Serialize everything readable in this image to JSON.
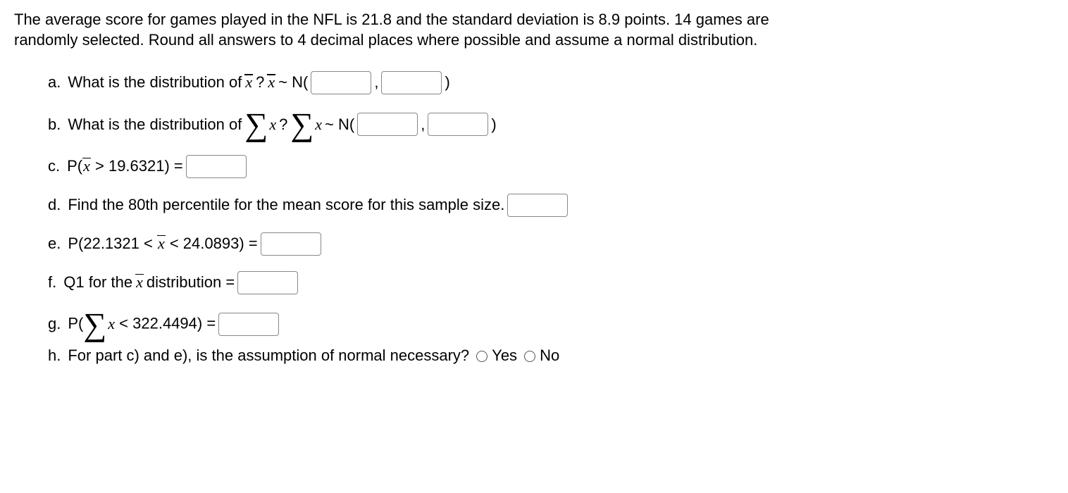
{
  "intro": "The average score for games played in the NFL is 21.8 and the standard deviation is 8.9 points. 14 games are randomly selected. Round all answers to 4 decimal places where possible and assume a normal distribution.",
  "a": {
    "label": "a.",
    "pre": "What is the distribution of ",
    "q": "? ",
    "dist": " ~ N(",
    "comma": ",",
    "close": ")"
  },
  "b": {
    "label": "b.",
    "pre": "What is the distribution of ",
    "q": "? ",
    "dist": " ~ N(",
    "comma": ",",
    "close": ")"
  },
  "c": {
    "label": "c.",
    "pre": "P(",
    "op": " > 19.6321) = "
  },
  "d": {
    "label": "d.",
    "text": "Find the 80th percentile for the mean score for this sample size. "
  },
  "e": {
    "label": "e.",
    "pre": "P(22.1321 < ",
    "post": " < 24.0893) = "
  },
  "f": {
    "label": "f.",
    "pre": "Q1 for the ",
    "post": " distribution = "
  },
  "g": {
    "label": "g.",
    "pre": "P(",
    "post": " < 322.4494) = "
  },
  "h": {
    "label": "h.",
    "text": "For part c) and e), is the assumption of normal necessary? ",
    "yes": "Yes",
    "no": "No"
  }
}
